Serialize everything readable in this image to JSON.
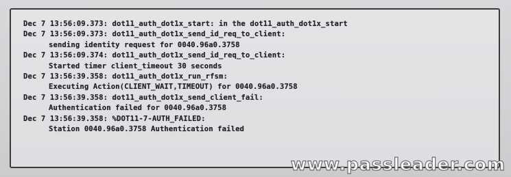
{
  "log_lines": [
    {
      "header": "Dec 7 13:56:09.373: dot11_auth_dot1x_start: in the dot11_auth_dot1x_start",
      "detail": ""
    },
    {
      "header": "Dec 7 13:56:09.373: dot11_auth_dot1x_send_id_req_to_client:",
      "detail": "sending identity request for 0040.96a0.3758"
    },
    {
      "header": "Dec 7 13:56:09.374: dot11_auth_dot1x_send_id_req_to_client:",
      "detail": "Started timer client_timeout 30 seconds"
    },
    {
      "header": "Dec 7 13:56:39.358: dot11_auth_dot1x_run_rfsm:",
      "detail": "Executing Action(CLIENT_WAIT,TIMEOUT) for 0040.96a0.3758"
    },
    {
      "header": "Dec 7 13:56:39.358: dot11_auth_dot1x_send_client_fail:",
      "detail": "Authentication failed for 0040.96a0.3758"
    },
    {
      "header": "Dec 7 13:56:39.358: %DOT11-7-AUTH_FAILED:",
      "detail": "Station 0040.96a0.3758 Authentication failed"
    }
  ],
  "watermark": "www.passleader.com",
  "colors": {
    "screen_background": "#dedee1",
    "text": "#1d1d22",
    "border": "#3a3a3a"
  }
}
